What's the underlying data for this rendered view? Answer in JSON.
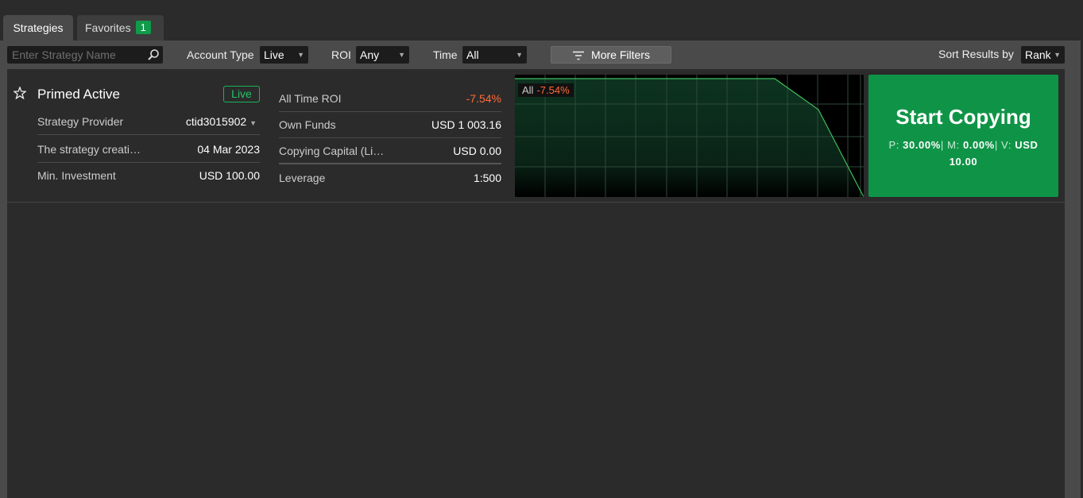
{
  "tabs": {
    "strategies": "Strategies",
    "favorites": "Favorites",
    "favorites_count": "1"
  },
  "filters": {
    "search_placeholder": "Enter Strategy Name",
    "account_type_label": "Account Type",
    "account_type_value": "Live",
    "roi_label": "ROI",
    "roi_value": "Any",
    "time_label": "Time",
    "time_value": "All",
    "more_filters": "More Filters",
    "sort_label": "Sort Results by",
    "sort_value": "Rank"
  },
  "strategy": {
    "name": "Primed Active",
    "account_badge": "Live",
    "details": [
      {
        "key": "Strategy Provider",
        "value": "ctid3015902"
      },
      {
        "key": "The strategy creati…",
        "value": "04 Mar 2023"
      },
      {
        "key": "Min. Investment",
        "value": "USD 100.00"
      }
    ],
    "stats": [
      {
        "key": "All Time ROI",
        "value": "-7.54%"
      },
      {
        "key": "Own Funds",
        "value": "USD 1 003.16"
      },
      {
        "key": "Copying Capital (Li…",
        "value": "USD 0.00"
      },
      {
        "key": "Leverage",
        "value": "1:500"
      }
    ],
    "chart": {
      "period": "All",
      "roi": "-7.54%"
    },
    "start_copying": {
      "label": "Start Copying",
      "performance_fee_label": "P:",
      "performance_fee": "30.00%",
      "management_fee_label": "M:",
      "management_fee": "0.00%",
      "volume_fee_label": "V:",
      "volume_fee": "USD 10.00"
    }
  },
  "colors": {
    "accent_green": "#0f9447",
    "negative": "#ff6b38",
    "panel": "#4a4a4a"
  }
}
